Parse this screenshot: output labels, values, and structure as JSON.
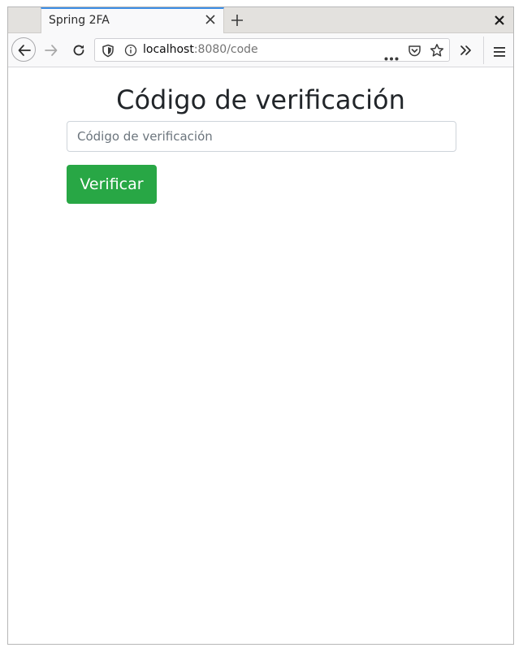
{
  "browser": {
    "tab": {
      "title": "Spring 2FA"
    },
    "url": {
      "host": "localhost",
      "rest": ":8080/code"
    },
    "icons": {
      "tab_close": "close-icon",
      "new_tab": "plus-icon",
      "window_close": "close-icon",
      "back": "arrow-left-icon",
      "forward": "arrow-right-icon",
      "reload": "reload-icon",
      "tracking_protection": "shield-icon",
      "site_info": "info-icon",
      "page_actions": "ellipsis-icon",
      "pocket": "pocket-icon",
      "bookmark": "star-icon",
      "overflow": "double-chevron-icon",
      "menu": "hamburger-menu-icon"
    }
  },
  "page": {
    "title": "Código de verificación",
    "code_input": {
      "placeholder": "Código de verificación",
      "value": ""
    },
    "verify_button": {
      "label": "Verificar"
    }
  },
  "colors": {
    "verify_button": "#28a745",
    "active_tab_accent": "#3d8ee6",
    "title_text": "#212529"
  }
}
